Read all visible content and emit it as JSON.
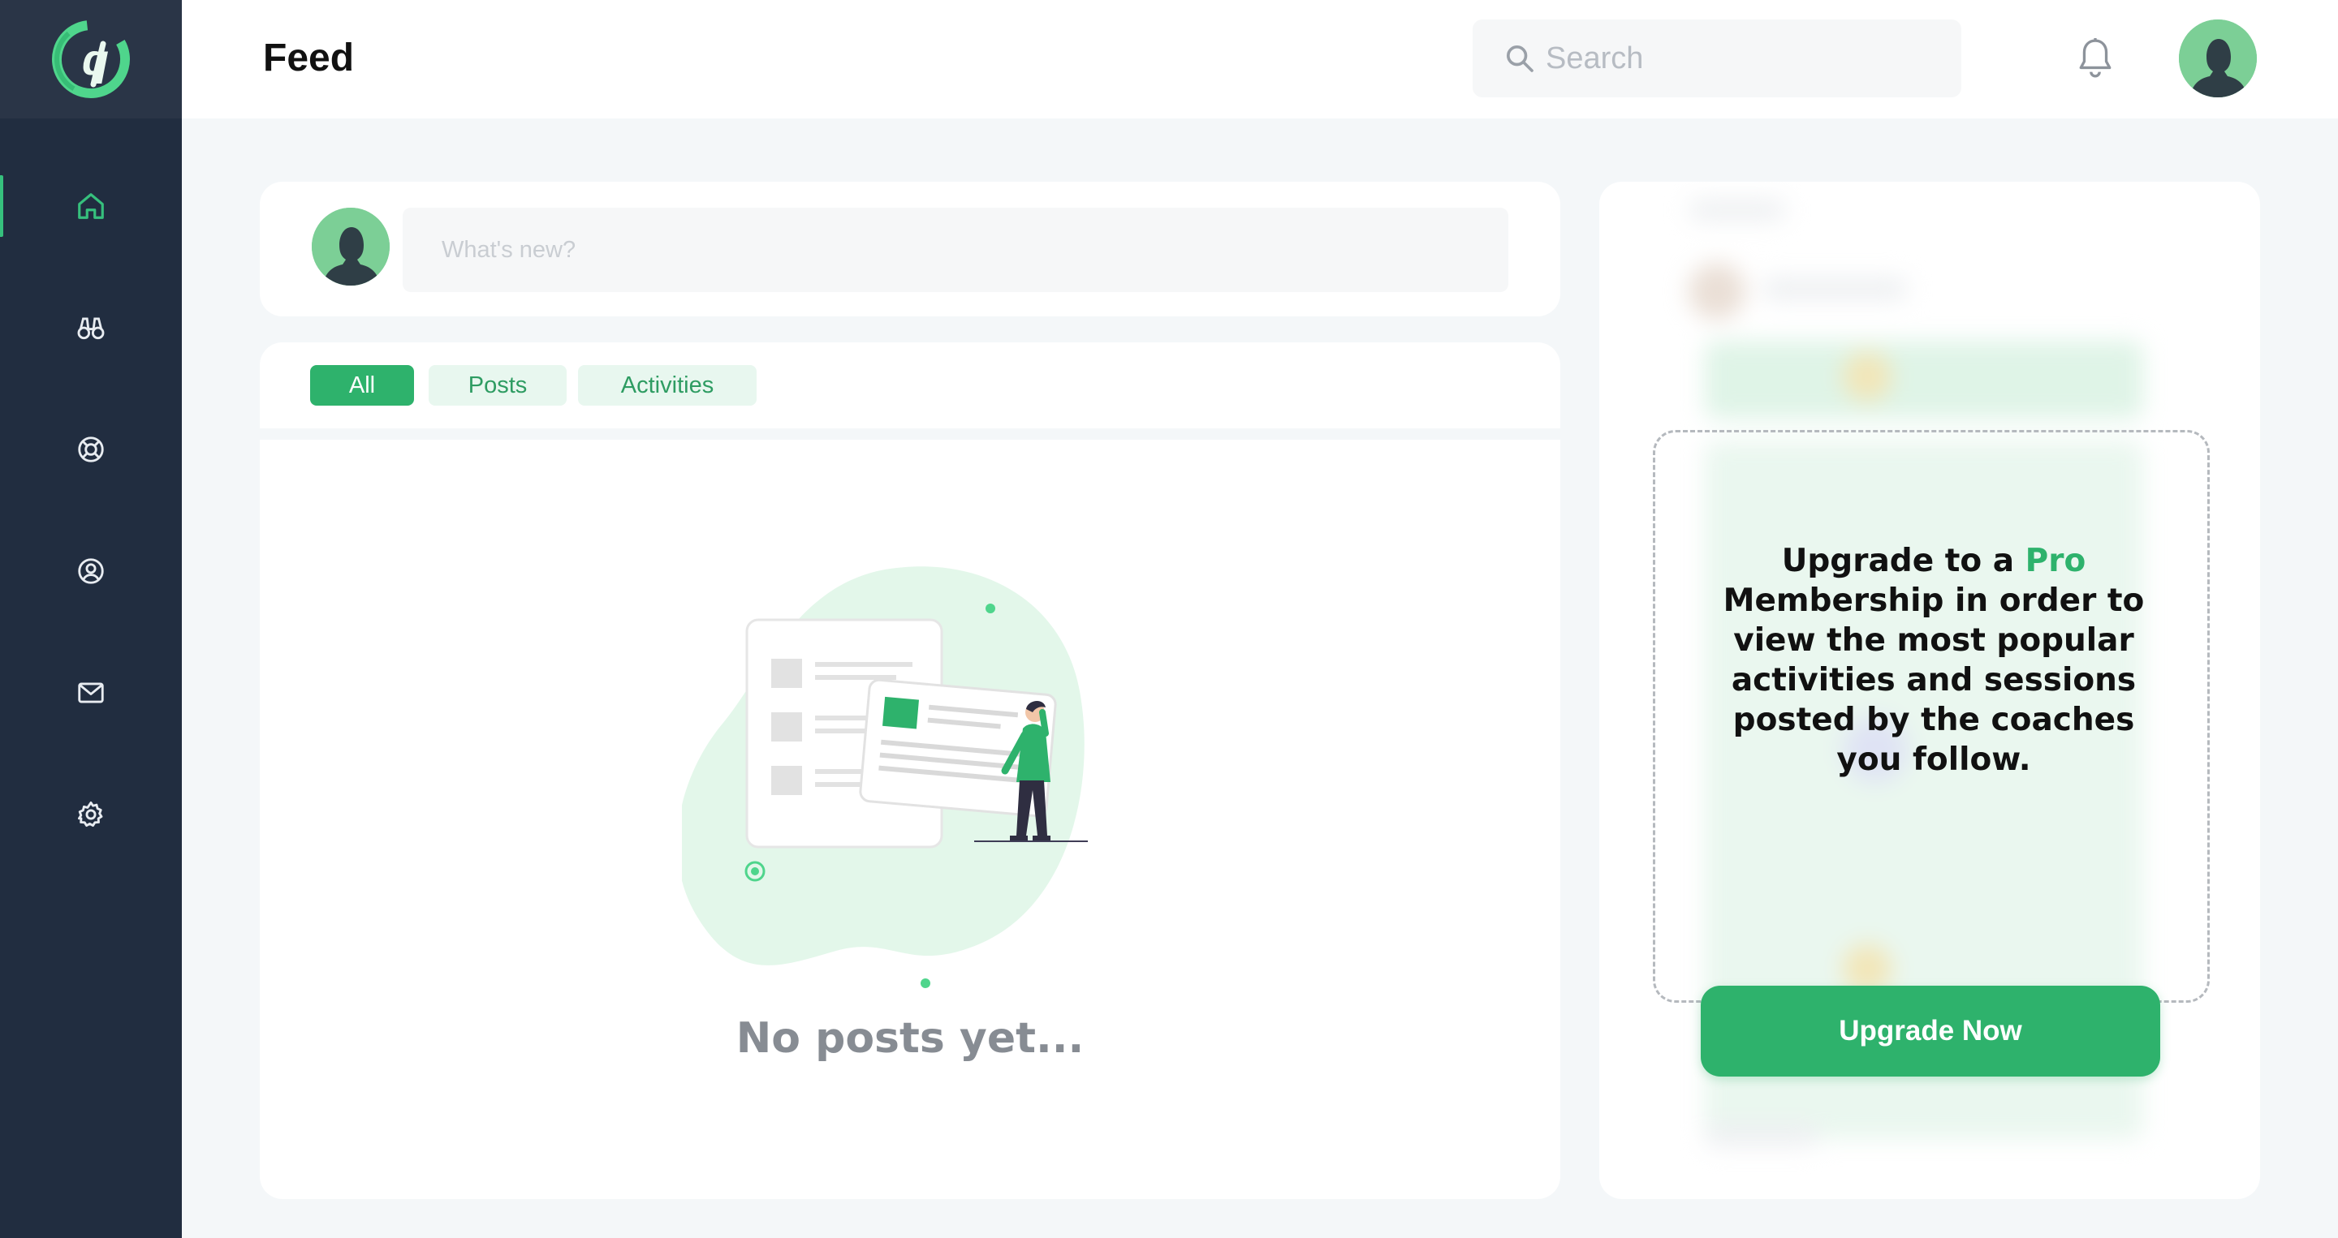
{
  "header": {
    "title": "Feed"
  },
  "search": {
    "placeholder": "Search"
  },
  "composer": {
    "placeholder": "What's new?"
  },
  "tabs": [
    {
      "label": "All",
      "active": true
    },
    {
      "label": "Posts",
      "active": false
    },
    {
      "label": "Activities",
      "active": false
    }
  ],
  "feed": {
    "empty_text": "No posts yet..."
  },
  "promo": {
    "text_before": "Upgrade to a ",
    "highlight": "Pro",
    "text_after": " Membership in order to view the most popular activities and sessions posted by the coaches you follow.",
    "button_label": "Upgrade Now"
  },
  "sidebar": {
    "items": [
      {
        "icon": "home-icon",
        "active": true
      },
      {
        "icon": "binoculars-icon",
        "active": false
      },
      {
        "icon": "lifebuoy-icon",
        "active": false
      },
      {
        "icon": "profile-icon",
        "active": false
      },
      {
        "icon": "mail-icon",
        "active": false
      },
      {
        "icon": "settings-icon",
        "active": false
      }
    ]
  },
  "colors": {
    "accent": "#2eb26c",
    "sidebar": "#212d40",
    "background": "#f4f7f9"
  }
}
